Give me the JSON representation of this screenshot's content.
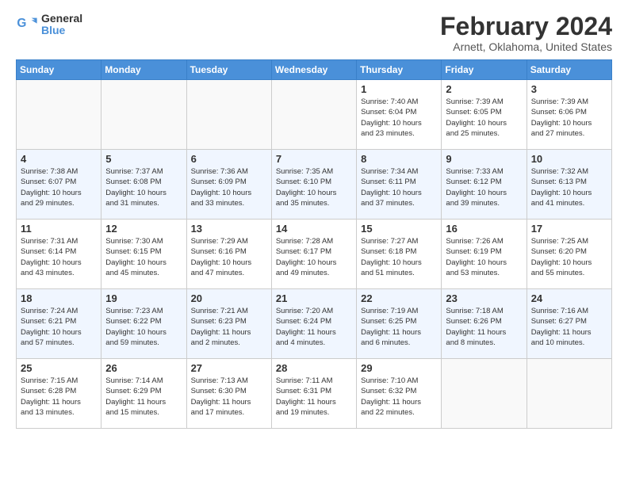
{
  "logo": {
    "line1": "General",
    "line2": "Blue"
  },
  "title": "February 2024",
  "subtitle": "Arnett, Oklahoma, United States",
  "days_header": [
    "Sunday",
    "Monday",
    "Tuesday",
    "Wednesday",
    "Thursday",
    "Friday",
    "Saturday"
  ],
  "weeks": [
    [
      {
        "day": "",
        "info": ""
      },
      {
        "day": "",
        "info": ""
      },
      {
        "day": "",
        "info": ""
      },
      {
        "day": "",
        "info": ""
      },
      {
        "day": "1",
        "info": "Sunrise: 7:40 AM\nSunset: 6:04 PM\nDaylight: 10 hours\nand 23 minutes."
      },
      {
        "day": "2",
        "info": "Sunrise: 7:39 AM\nSunset: 6:05 PM\nDaylight: 10 hours\nand 25 minutes."
      },
      {
        "day": "3",
        "info": "Sunrise: 7:39 AM\nSunset: 6:06 PM\nDaylight: 10 hours\nand 27 minutes."
      }
    ],
    [
      {
        "day": "4",
        "info": "Sunrise: 7:38 AM\nSunset: 6:07 PM\nDaylight: 10 hours\nand 29 minutes."
      },
      {
        "day": "5",
        "info": "Sunrise: 7:37 AM\nSunset: 6:08 PM\nDaylight: 10 hours\nand 31 minutes."
      },
      {
        "day": "6",
        "info": "Sunrise: 7:36 AM\nSunset: 6:09 PM\nDaylight: 10 hours\nand 33 minutes."
      },
      {
        "day": "7",
        "info": "Sunrise: 7:35 AM\nSunset: 6:10 PM\nDaylight: 10 hours\nand 35 minutes."
      },
      {
        "day": "8",
        "info": "Sunrise: 7:34 AM\nSunset: 6:11 PM\nDaylight: 10 hours\nand 37 minutes."
      },
      {
        "day": "9",
        "info": "Sunrise: 7:33 AM\nSunset: 6:12 PM\nDaylight: 10 hours\nand 39 minutes."
      },
      {
        "day": "10",
        "info": "Sunrise: 7:32 AM\nSunset: 6:13 PM\nDaylight: 10 hours\nand 41 minutes."
      }
    ],
    [
      {
        "day": "11",
        "info": "Sunrise: 7:31 AM\nSunset: 6:14 PM\nDaylight: 10 hours\nand 43 minutes."
      },
      {
        "day": "12",
        "info": "Sunrise: 7:30 AM\nSunset: 6:15 PM\nDaylight: 10 hours\nand 45 minutes."
      },
      {
        "day": "13",
        "info": "Sunrise: 7:29 AM\nSunset: 6:16 PM\nDaylight: 10 hours\nand 47 minutes."
      },
      {
        "day": "14",
        "info": "Sunrise: 7:28 AM\nSunset: 6:17 PM\nDaylight: 10 hours\nand 49 minutes."
      },
      {
        "day": "15",
        "info": "Sunrise: 7:27 AM\nSunset: 6:18 PM\nDaylight: 10 hours\nand 51 minutes."
      },
      {
        "day": "16",
        "info": "Sunrise: 7:26 AM\nSunset: 6:19 PM\nDaylight: 10 hours\nand 53 minutes."
      },
      {
        "day": "17",
        "info": "Sunrise: 7:25 AM\nSunset: 6:20 PM\nDaylight: 10 hours\nand 55 minutes."
      }
    ],
    [
      {
        "day": "18",
        "info": "Sunrise: 7:24 AM\nSunset: 6:21 PM\nDaylight: 10 hours\nand 57 minutes."
      },
      {
        "day": "19",
        "info": "Sunrise: 7:23 AM\nSunset: 6:22 PM\nDaylight: 10 hours\nand 59 minutes."
      },
      {
        "day": "20",
        "info": "Sunrise: 7:21 AM\nSunset: 6:23 PM\nDaylight: 11 hours\nand 2 minutes."
      },
      {
        "day": "21",
        "info": "Sunrise: 7:20 AM\nSunset: 6:24 PM\nDaylight: 11 hours\nand 4 minutes."
      },
      {
        "day": "22",
        "info": "Sunrise: 7:19 AM\nSunset: 6:25 PM\nDaylight: 11 hours\nand 6 minutes."
      },
      {
        "day": "23",
        "info": "Sunrise: 7:18 AM\nSunset: 6:26 PM\nDaylight: 11 hours\nand 8 minutes."
      },
      {
        "day": "24",
        "info": "Sunrise: 7:16 AM\nSunset: 6:27 PM\nDaylight: 11 hours\nand 10 minutes."
      }
    ],
    [
      {
        "day": "25",
        "info": "Sunrise: 7:15 AM\nSunset: 6:28 PM\nDaylight: 11 hours\nand 13 minutes."
      },
      {
        "day": "26",
        "info": "Sunrise: 7:14 AM\nSunset: 6:29 PM\nDaylight: 11 hours\nand 15 minutes."
      },
      {
        "day": "27",
        "info": "Sunrise: 7:13 AM\nSunset: 6:30 PM\nDaylight: 11 hours\nand 17 minutes."
      },
      {
        "day": "28",
        "info": "Sunrise: 7:11 AM\nSunset: 6:31 PM\nDaylight: 11 hours\nand 19 minutes."
      },
      {
        "day": "29",
        "info": "Sunrise: 7:10 AM\nSunset: 6:32 PM\nDaylight: 11 hours\nand 22 minutes."
      },
      {
        "day": "",
        "info": ""
      },
      {
        "day": "",
        "info": ""
      }
    ]
  ]
}
